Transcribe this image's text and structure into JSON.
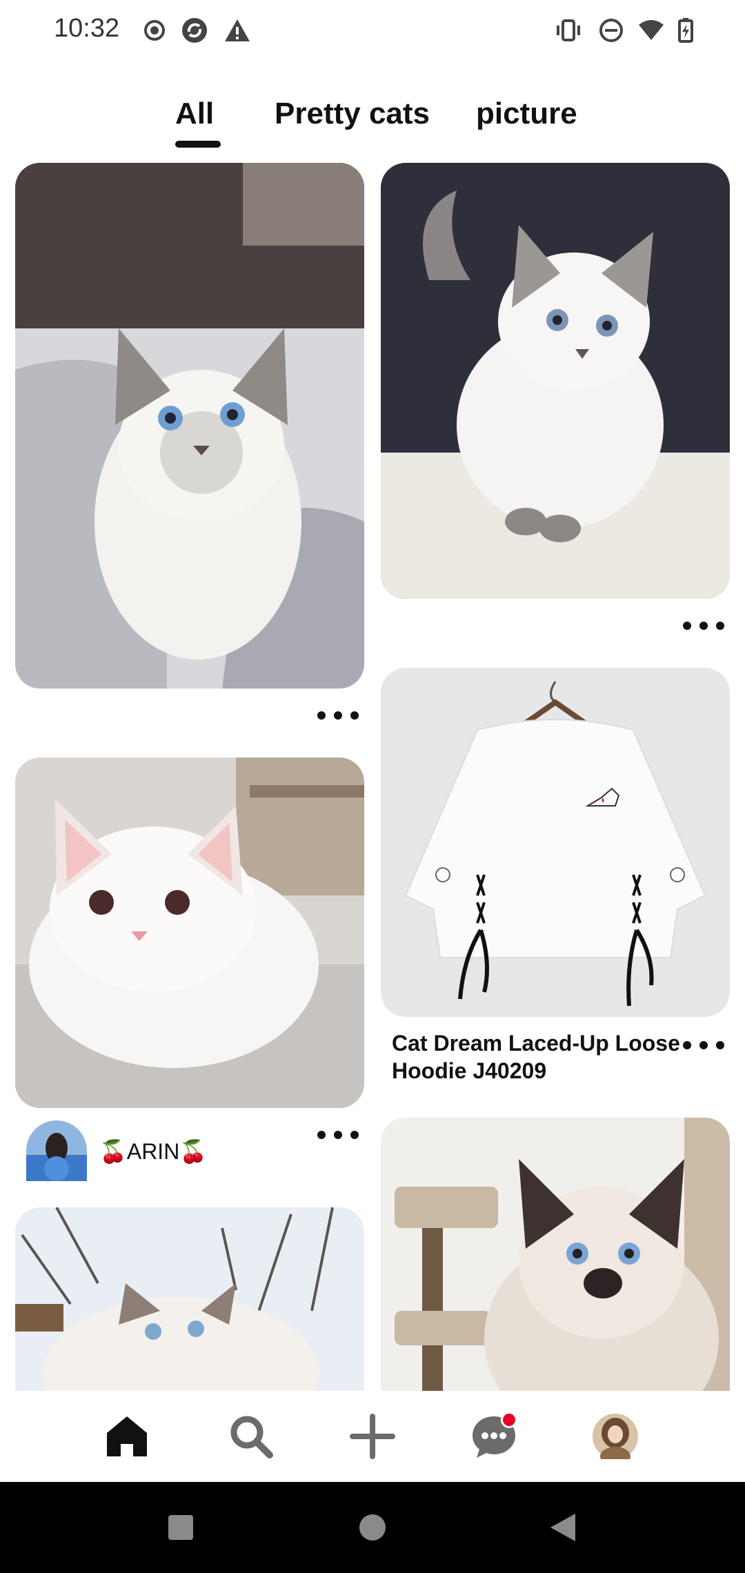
{
  "status_bar": {
    "time": "10:32"
  },
  "tabs": [
    {
      "label": "All",
      "active": true
    },
    {
      "label": "Pretty cats",
      "active": false
    },
    {
      "label": "picture",
      "active": false
    }
  ],
  "pins": {
    "p2": {
      "caption_line1": "Cat Dream Laced-Up Loose",
      "caption_line2": "Hoodie J40209"
    },
    "p3": {
      "pinner_name": "🍒ARIN🍒"
    }
  },
  "bottom_nav": {
    "items": [
      "home-icon",
      "search-icon",
      "create-icon",
      "messages-icon",
      "profile-avatar"
    ],
    "notification_color": "#e60023"
  },
  "colors": {
    "accent": "#111111",
    "badge": "#e60023"
  }
}
